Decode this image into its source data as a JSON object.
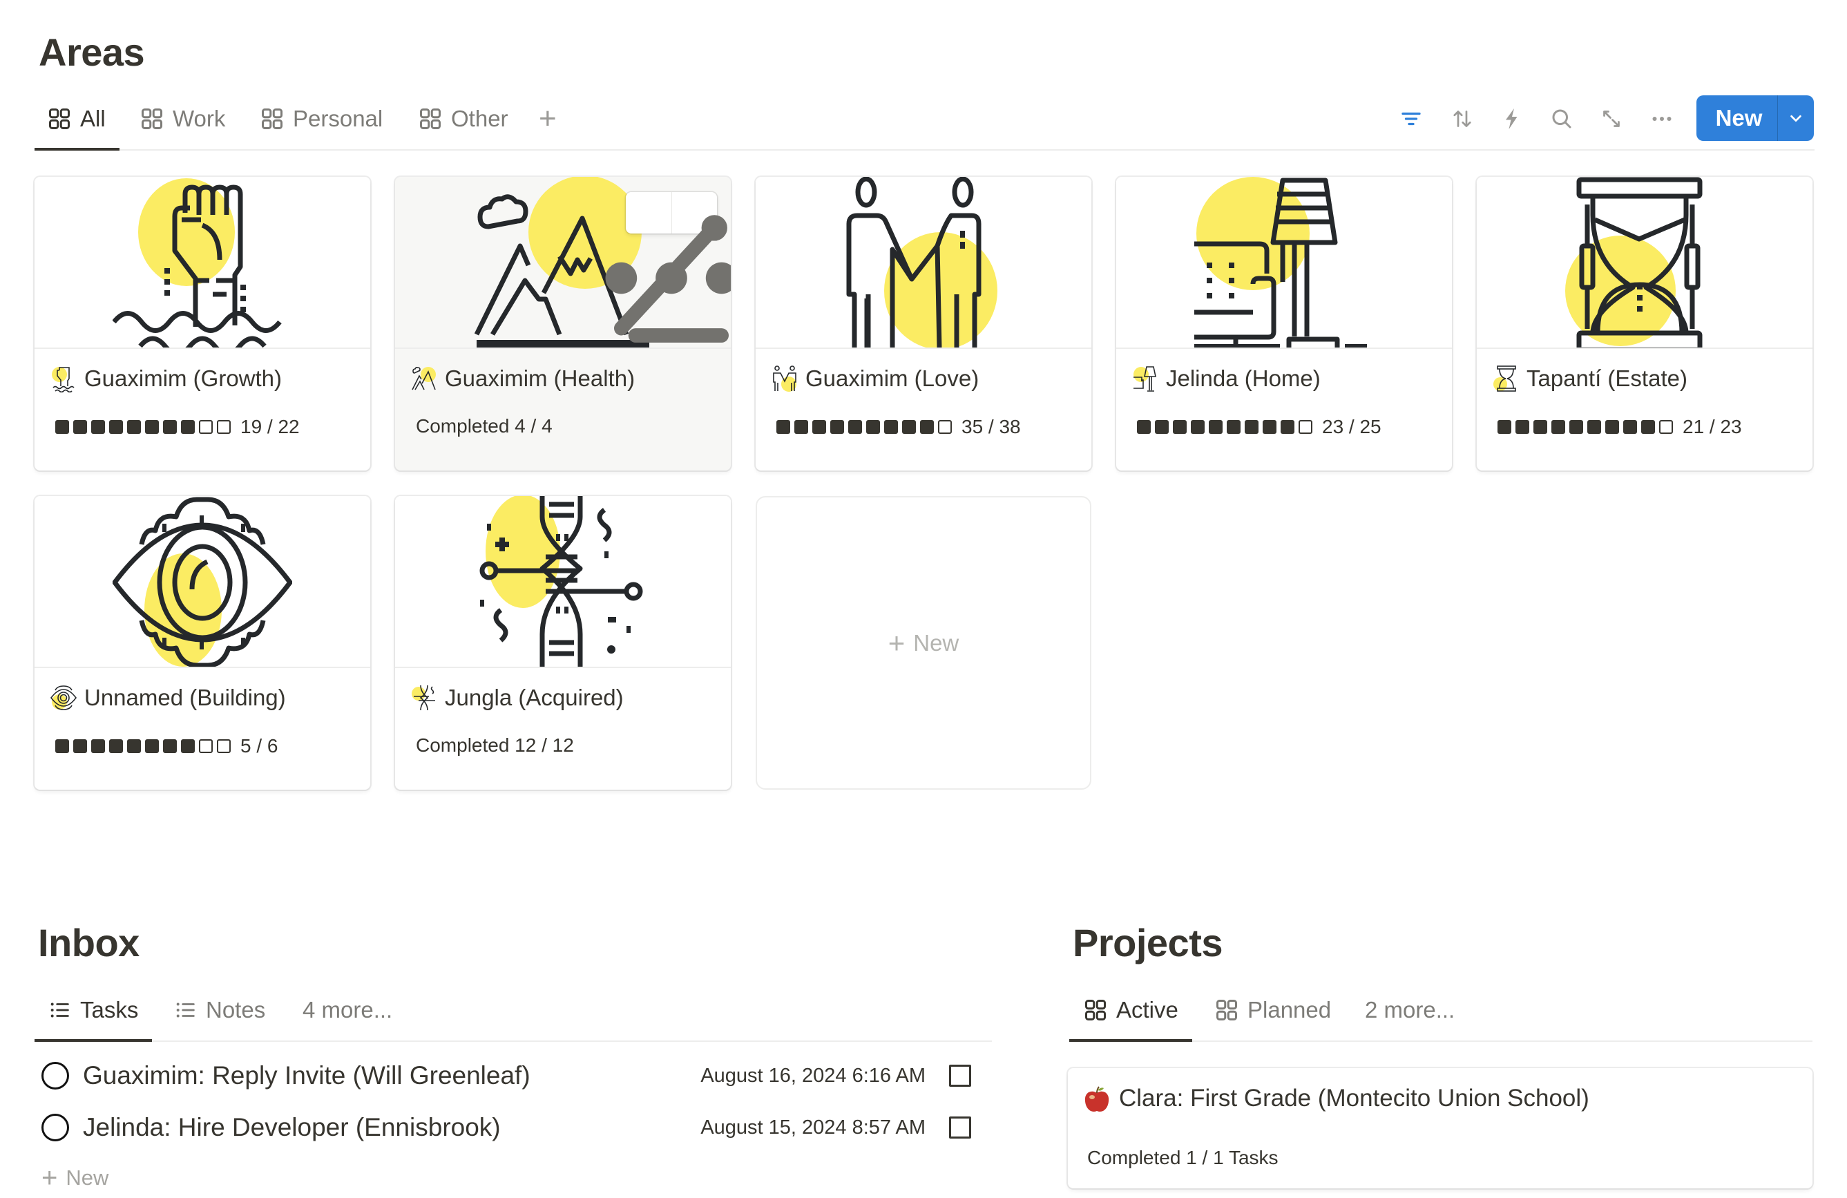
{
  "areas": {
    "title": "Areas",
    "tabs": [
      {
        "label": "All",
        "icon": "gallery-icon",
        "active": true
      },
      {
        "label": "Work",
        "icon": "gallery-icon",
        "active": false
      },
      {
        "label": "Personal",
        "icon": "gallery-icon",
        "active": false
      },
      {
        "label": "Other",
        "icon": "gallery-icon",
        "active": false
      }
    ],
    "add_view": "+",
    "toolbar": {
      "icons": [
        "filter-icon",
        "sort-icon",
        "automation-icon",
        "search-icon",
        "expand-icon",
        "more-icon"
      ],
      "new_label": "New",
      "accent_color": "#2f80da",
      "filter_color": "#2f80da"
    },
    "cards": [
      {
        "title": "Guaximim (Growth)",
        "icon": "raised-fist-icon",
        "type": "progress",
        "filled": 8,
        "empty": 2,
        "done": 19,
        "total": 22,
        "count": "19 / 22"
      },
      {
        "title": "Guaximim (Health)",
        "icon": "mountain-icon",
        "type": "completed",
        "completed": "Completed 4 / 4",
        "hovered": true
      },
      {
        "title": "Guaximim (Love)",
        "icon": "couple-icon",
        "type": "progress",
        "filled": 9,
        "empty": 1,
        "done": 35,
        "total": 38,
        "count": "35 / 38"
      },
      {
        "title": "Jelinda (Home)",
        "icon": "sofa-lamp-icon",
        "type": "progress",
        "filled": 9,
        "empty": 1,
        "done": 23,
        "total": 25,
        "count": "23 / 25"
      },
      {
        "title": "Tapantí (Estate)",
        "icon": "hourglass-icon",
        "type": "progress",
        "filled": 9,
        "empty": 1,
        "done": 21,
        "total": 23,
        "count": "21 / 23"
      },
      {
        "title": "Unnamed (Building)",
        "icon": "eye-gear-icon",
        "type": "progress",
        "filled": 8,
        "empty": 2,
        "done": 5,
        "total": 6,
        "count": "5 / 6"
      },
      {
        "title": "Jungla (Acquired)",
        "icon": "dna-icon",
        "type": "completed",
        "completed": "Completed 12 / 12"
      }
    ],
    "new_card_label": "New",
    "accent_yellow": "#fbec63"
  },
  "inbox": {
    "title": "Inbox",
    "tabs": [
      {
        "label": "Tasks",
        "icon": "list-icon",
        "active": true
      },
      {
        "label": "Notes",
        "icon": "list-icon",
        "active": false
      },
      {
        "label": "4 more...",
        "icon": "",
        "active": false
      }
    ],
    "tasks": [
      {
        "name": "Guaximim: Reply Invite (Will Greenleaf)",
        "date": "August 16, 2024 6:16 AM",
        "checked": false
      },
      {
        "name": "Jelinda: Hire Developer (Ennisbrook)",
        "date": "August 15, 2024 8:57 AM",
        "checked": false
      }
    ],
    "new_label": "New"
  },
  "projects": {
    "title": "Projects",
    "tabs": [
      {
        "label": "Active",
        "icon": "gallery-icon",
        "active": true
      },
      {
        "label": "Planned",
        "icon": "gallery-icon",
        "active": false
      },
      {
        "label": "2 more...",
        "icon": "",
        "active": false
      }
    ],
    "cards": [
      {
        "title": "Clara: First Grade (Montecito Union School)",
        "icon": "apple-icon",
        "subtitle": "Completed 1 / 1 Tasks"
      }
    ]
  }
}
